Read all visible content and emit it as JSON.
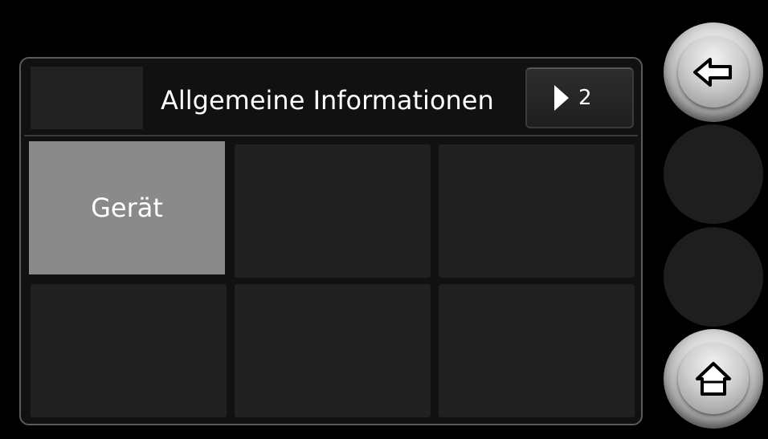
{
  "header": {
    "title": "Allgemeine Informationen",
    "page_number": "2"
  },
  "grid": {
    "tiles": [
      {
        "label": "Gerät",
        "active": true
      },
      {
        "label": "",
        "active": false
      },
      {
        "label": "",
        "active": false
      },
      {
        "label": "",
        "active": false
      },
      {
        "label": "",
        "active": false
      },
      {
        "label": "",
        "active": false
      }
    ]
  },
  "side_buttons": {
    "back_icon": "arrow-left-icon",
    "home_icon": "home-icon"
  },
  "colors": {
    "background": "#000000",
    "tile": "#212121",
    "tile_active": "#8a8a8a",
    "text": "#ffffff"
  }
}
